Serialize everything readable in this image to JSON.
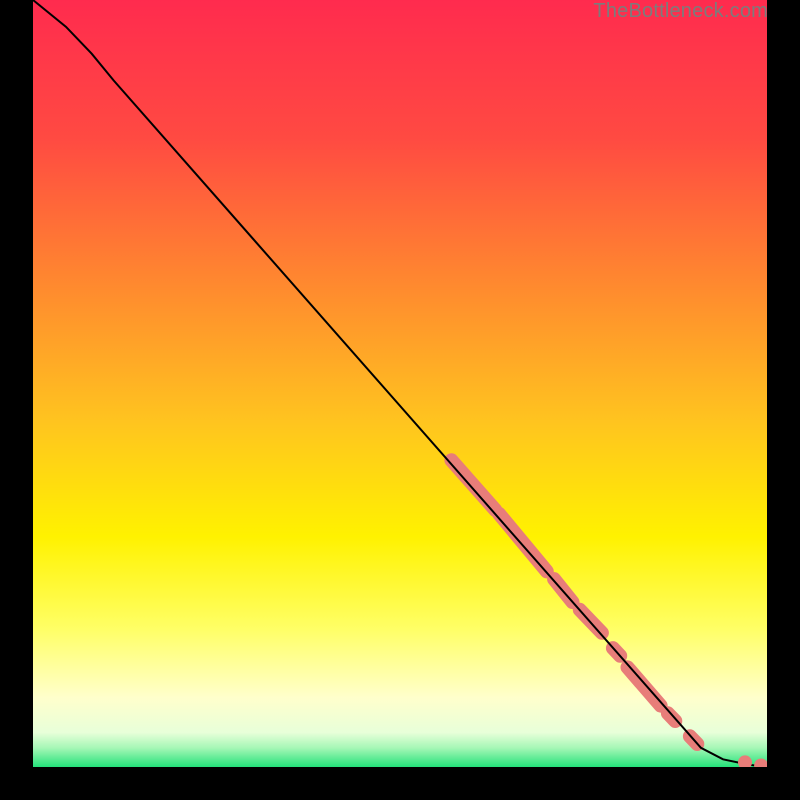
{
  "watermark": "TheBottleneck.com",
  "chart_data": {
    "type": "line",
    "title": "",
    "xlabel": "",
    "ylabel": "",
    "xlim": [
      0,
      100
    ],
    "ylim": [
      0,
      100
    ],
    "grid": false,
    "gradient_stops": [
      {
        "offset": 0.0,
        "color": "#ff2b4e"
      },
      {
        "offset": 0.18,
        "color": "#ff4a42"
      },
      {
        "offset": 0.38,
        "color": "#ff8c2e"
      },
      {
        "offset": 0.55,
        "color": "#ffc41f"
      },
      {
        "offset": 0.7,
        "color": "#fff200"
      },
      {
        "offset": 0.82,
        "color": "#ffff66"
      },
      {
        "offset": 0.91,
        "color": "#ffffcc"
      },
      {
        "offset": 0.955,
        "color": "#e8ffd9"
      },
      {
        "offset": 0.975,
        "color": "#a6f7b6"
      },
      {
        "offset": 1.0,
        "color": "#24e27a"
      }
    ],
    "series": [
      {
        "name": "bottleneck-curve",
        "color": "#000000",
        "stroke_width": 2,
        "points": [
          {
            "x": 0.0,
            "y": 100.0
          },
          {
            "x": 4.5,
            "y": 96.5
          },
          {
            "x": 8.0,
            "y": 93.0
          },
          {
            "x": 11.0,
            "y": 89.5
          },
          {
            "x": 91.0,
            "y": 2.5
          },
          {
            "x": 94.0,
            "y": 1.0
          },
          {
            "x": 97.5,
            "y": 0.3
          },
          {
            "x": 100.0,
            "y": 0.0
          }
        ]
      }
    ],
    "clusters": {
      "name": "highlighted-points",
      "color": "#e87d79",
      "radius": 7,
      "segments": [
        {
          "x0": 57.0,
          "y0": 40.0,
          "x1": 63.0,
          "y1": 33.5
        },
        {
          "x0": 63.5,
          "y0": 33.0,
          "x1": 70.0,
          "y1": 25.5
        },
        {
          "x0": 71.0,
          "y0": 24.5,
          "x1": 73.5,
          "y1": 21.5
        },
        {
          "x0": 74.5,
          "y0": 20.5,
          "x1": 77.5,
          "y1": 17.5
        },
        {
          "x0": 79.0,
          "y0": 15.5,
          "x1": 80.0,
          "y1": 14.5
        },
        {
          "x0": 81.0,
          "y0": 13.0,
          "x1": 85.5,
          "y1": 8.0
        },
        {
          "x0": 86.5,
          "y0": 7.0,
          "x1": 87.5,
          "y1": 6.0
        },
        {
          "x0": 89.5,
          "y0": 4.0,
          "x1": 90.5,
          "y1": 3.0
        }
      ],
      "dots": [
        {
          "x": 97.0,
          "y": 0.6
        },
        {
          "x": 99.2,
          "y": 0.2
        }
      ]
    }
  }
}
